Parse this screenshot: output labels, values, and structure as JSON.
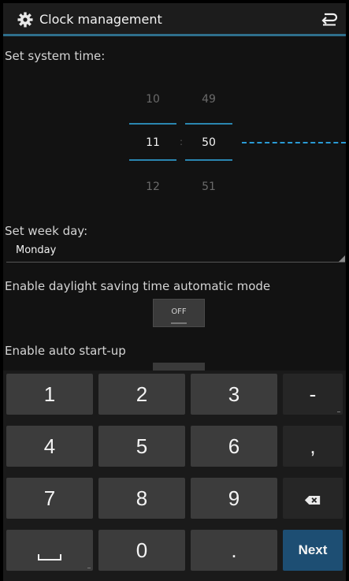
{
  "actionbar": {
    "title": "Clock management",
    "icons": {
      "settings": "gear-icon",
      "back": "return-icon"
    }
  },
  "system_time": {
    "label": "Set system time:",
    "hour": {
      "prev": "10",
      "selected": "11",
      "next": "12"
    },
    "minute": {
      "prev": "49",
      "selected": "50",
      "next": "51"
    }
  },
  "week_day": {
    "label": "Set week day:",
    "selected": "Monday"
  },
  "dst": {
    "label": "Enable daylight saving time automatic mode",
    "toggle": "OFF"
  },
  "autostart": {
    "label": "Enable auto start-up"
  },
  "keyboard": {
    "k1": "1",
    "k2": "2",
    "k3": "3",
    "dash": "-",
    "k4": "4",
    "k5": "5",
    "k6": "6",
    "comma": ",",
    "k7": "7",
    "k8": "8",
    "k9": "9",
    "k0": "0",
    "dot": ".",
    "next": "Next",
    "icons": {
      "space": "space-icon",
      "backspace": "backspace-icon"
    }
  },
  "colors": {
    "accent": "#2a86b0",
    "next_key": "#1d4e73"
  }
}
